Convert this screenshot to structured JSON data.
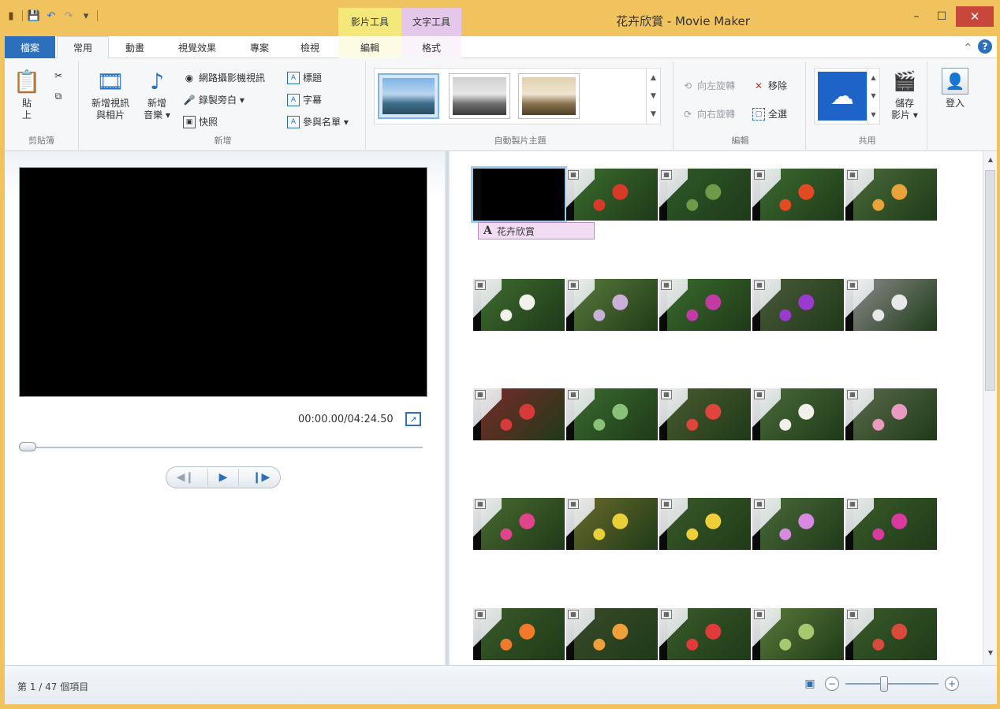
{
  "window": {
    "title": "花卉欣賞 - Movie Maker",
    "context_tabs": {
      "video_tools": "影片工具",
      "text_tools": "文字工具"
    },
    "controls": {
      "minimize": "–",
      "maximize": "☐",
      "close": "✕"
    }
  },
  "qat": {
    "save": "💾",
    "undo": "↶",
    "redo": "↷",
    "customize": "▾"
  },
  "tabs": {
    "file": "檔案",
    "home": "常用",
    "animations": "動畫",
    "visual_effects": "視覺效果",
    "project": "專案",
    "view": "檢視",
    "edit": "編輯",
    "format": "格式"
  },
  "ribbon": {
    "clipboard": {
      "label": "剪貼簿",
      "paste_line1": "貼",
      "paste_line2": "上",
      "cut": "✂",
      "copy": "⧉"
    },
    "add": {
      "label": "新增",
      "add_videos_line1": "新增視訊",
      "add_videos_line2": "與相片",
      "add_music_line1": "新增",
      "add_music_line2": "音樂 ▾",
      "webcam": "網路攝影機視訊",
      "narration": "錄製旁白 ▾",
      "snapshot": "快照",
      "title": "標題",
      "caption": "字幕",
      "credits": "參與名單 ▾"
    },
    "themes": {
      "label": "自動製片主題"
    },
    "editing": {
      "label": "編輯",
      "rotate_left": "向左旋轉",
      "rotate_right": "向右旋轉",
      "remove": "移除",
      "select_all": "全選"
    },
    "share": {
      "label": "共用",
      "save_movie_line1": "儲存",
      "save_movie_line2": "影片 ▾",
      "sign_in": "登入"
    }
  },
  "preview": {
    "timecode": "00:00.00/04:24.50"
  },
  "storyboard": {
    "caption_text": "花卉欣賞"
  },
  "status": {
    "item_count": "第 1 / 47 個項目"
  },
  "colors": {
    "titlebar": "#f0c35f",
    "file_tab": "#2b6fbd",
    "video_tools": "#f4e87a",
    "text_tools": "#e6c7ec",
    "accent": "#2b6fbd"
  }
}
